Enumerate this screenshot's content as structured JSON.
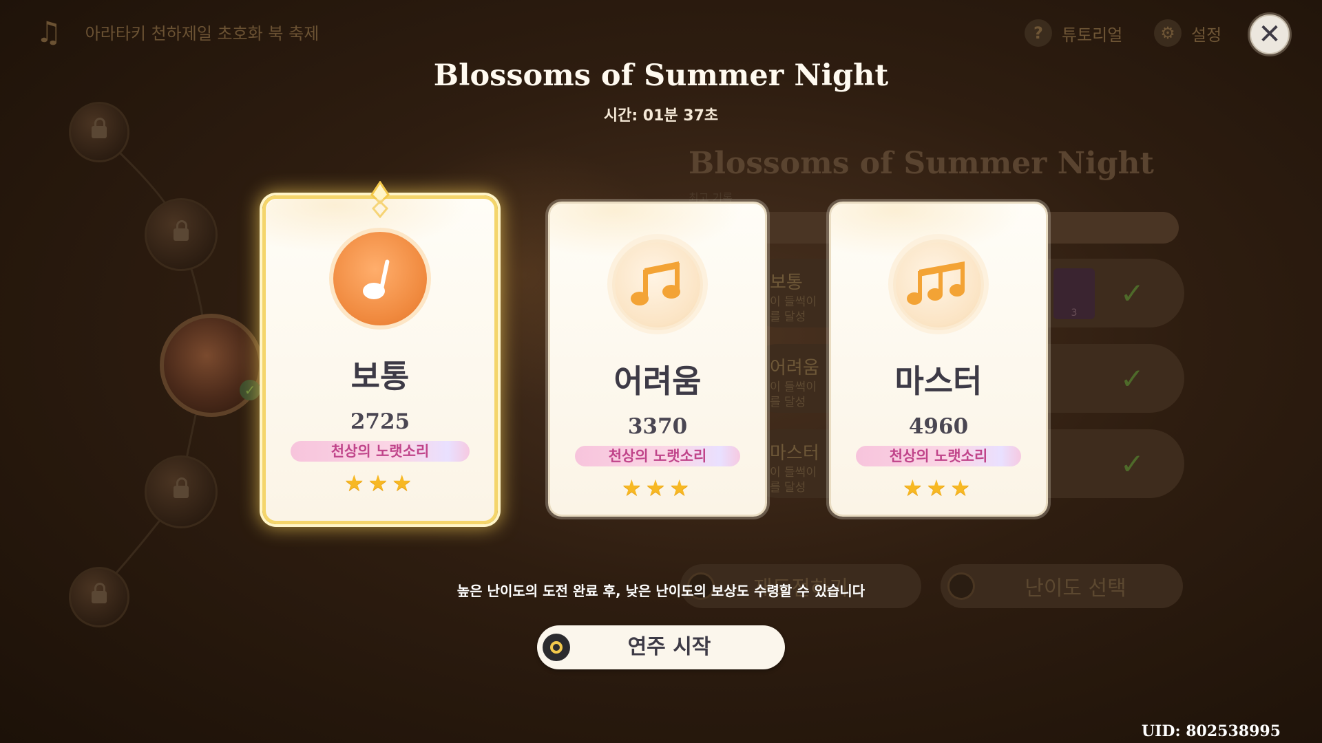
{
  "background": {
    "event_title": "아라타키 천하제일 초호화 북 축제",
    "song_title": "Blossoms of Summer Night",
    "best_record_label": "최고 기록",
    "rows": [
      {
        "label": "보통",
        "desc1": "이 들썩이",
        "desc2": "를 달성"
      },
      {
        "label": "어려움",
        "desc1": "이 들썩이",
        "desc2": "를 달성"
      },
      {
        "label": "마스터",
        "desc1": "이 들썩이",
        "desc2": "를 달성"
      }
    ],
    "reward_count": "3",
    "btn_left": "재도전하기",
    "btn_right": "난이도 선택"
  },
  "top_bar": {
    "tutorial_label": "튜토리얼",
    "settings_label": "설정",
    "tutorial_icon": "?"
  },
  "modal": {
    "title": "Blossoms of Summer Night",
    "time": "시간: 01분 37초",
    "cards": [
      {
        "level": "보통",
        "score": "2725",
        "badge": "천상의 노랫소리",
        "stars": 3,
        "stars_text": "★★★",
        "icon": "single-note-icon",
        "selected": true
      },
      {
        "level": "어려움",
        "score": "3370",
        "badge": "천상의 노랫소리",
        "stars": 3,
        "stars_text": "★★★",
        "icon": "double-note-icon",
        "selected": false
      },
      {
        "level": "마스터",
        "score": "4960",
        "badge": "천상의 노랫소리",
        "stars": 3,
        "stars_text": "★★★",
        "icon": "triple-note-icon",
        "selected": false
      }
    ],
    "hint": "높은 난이도의 도전 완료 후, 낮은 난이도의 보상도 수령할 수 있습니다",
    "start_label": "연주 시작"
  },
  "uid": "UID: 802538995",
  "colors": {
    "accent": "#f08a3f",
    "badge_text": "#c0448a",
    "star": "#f7b823",
    "selected_border": "#f4d56b"
  }
}
